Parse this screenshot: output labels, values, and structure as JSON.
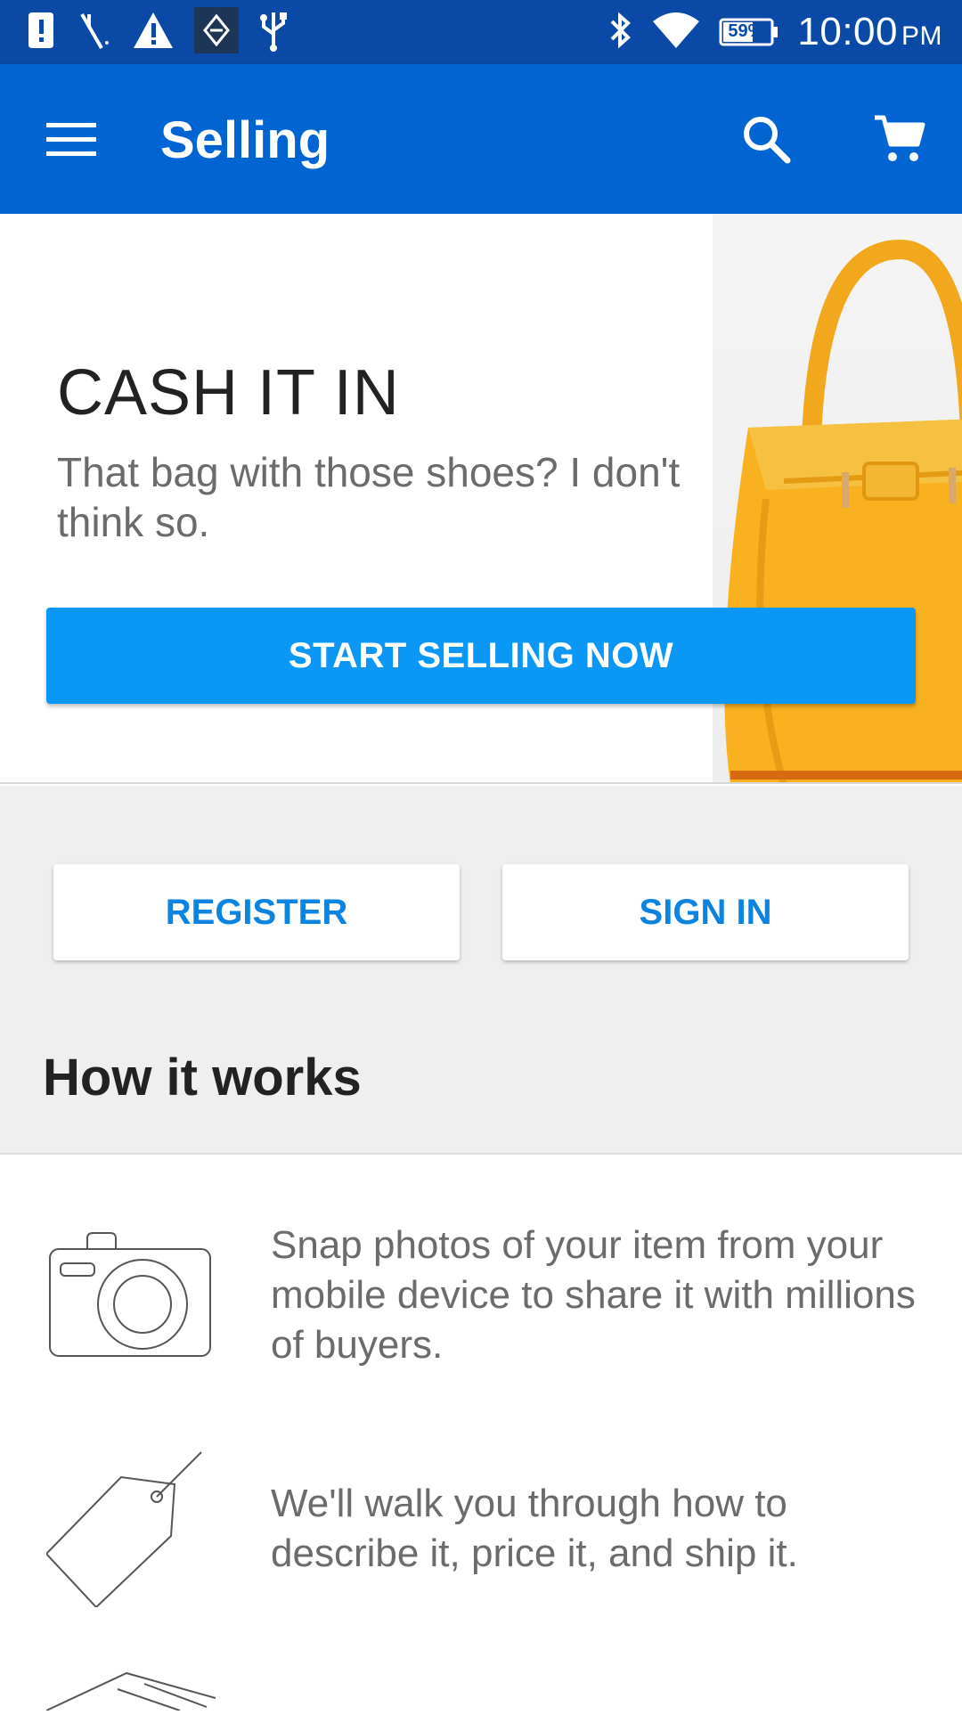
{
  "status_bar": {
    "time": "10:00",
    "ampm": "PM",
    "battery": "59%",
    "left_icons": [
      "alert-icon",
      "signal-slash-icon",
      "warning-icon",
      "app-notification-icon",
      "usb-icon"
    ],
    "right_icons": [
      "bluetooth-icon",
      "wifi-icon",
      "battery-icon"
    ]
  },
  "app_bar": {
    "title": "Selling",
    "icons": [
      "menu-icon",
      "search-icon",
      "cart-icon"
    ]
  },
  "hero": {
    "title": "CASH IT IN",
    "subtitle": "That bag with those shoes? I don't think so.",
    "cta_label": "START SELLING NOW",
    "image": "yellow-handbag"
  },
  "auth": {
    "register_label": "REGISTER",
    "signin_label": "SIGN IN"
  },
  "how_it_works": {
    "heading": "How it works",
    "steps": [
      {
        "icon": "camera-icon",
        "text": "Snap photos of your item from your mobile device to share it with millions of buyers."
      },
      {
        "icon": "price-tag-icon",
        "text": "We'll walk you through how to describe it, price it, and ship it."
      },
      {
        "icon": "shipping-box-icon",
        "text": ""
      }
    ]
  },
  "colors": {
    "status_bar": "#0a4aa6",
    "app_bar": "#0064d2",
    "cta": "#0a97f5",
    "link_blue": "#0a84e0",
    "gray_bg": "#efefef"
  }
}
